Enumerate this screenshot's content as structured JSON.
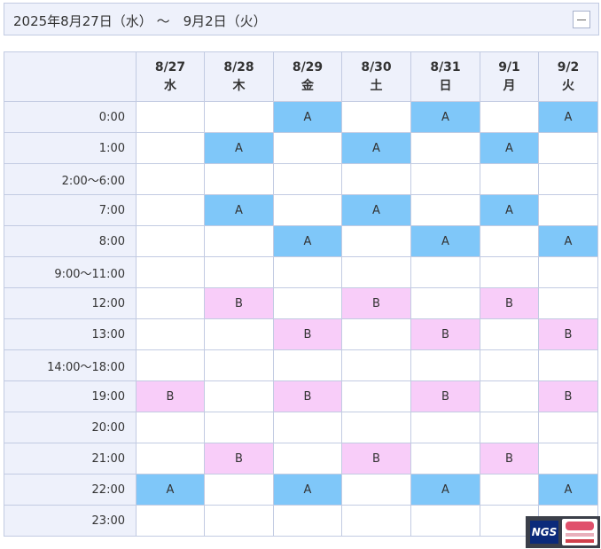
{
  "header": {
    "title": "2025年8月27日（水） ～　9月2日（火）"
  },
  "columns": [
    {
      "date": "8/27",
      "weekday": "水"
    },
    {
      "date": "8/28",
      "weekday": "木"
    },
    {
      "date": "8/29",
      "weekday": "金"
    },
    {
      "date": "8/30",
      "weekday": "土"
    },
    {
      "date": "8/31",
      "weekday": "日"
    },
    {
      "date": "9/1",
      "weekday": "月"
    },
    {
      "date": "9/2",
      "weekday": "火"
    }
  ],
  "rows": [
    {
      "time": "0:00",
      "cells": [
        "",
        "",
        "A",
        "",
        "A",
        "",
        "A"
      ]
    },
    {
      "time": "1:00",
      "cells": [
        "",
        "A",
        "",
        "A",
        "",
        "A",
        ""
      ]
    },
    {
      "time": "2:00～6:00",
      "cells": [
        "",
        "",
        "",
        "",
        "",
        "",
        ""
      ]
    },
    {
      "time": "7:00",
      "cells": [
        "",
        "A",
        "",
        "A",
        "",
        "A",
        ""
      ]
    },
    {
      "time": "8:00",
      "cells": [
        "",
        "",
        "A",
        "",
        "A",
        "",
        "A"
      ]
    },
    {
      "time": "9:00～11:00",
      "cells": [
        "",
        "",
        "",
        "",
        "",
        "",
        ""
      ]
    },
    {
      "time": "12:00",
      "cells": [
        "",
        "B",
        "",
        "B",
        "",
        "B",
        ""
      ]
    },
    {
      "time": "13:00",
      "cells": [
        "",
        "",
        "B",
        "",
        "B",
        "",
        "B"
      ]
    },
    {
      "time": "14:00～18:00",
      "cells": [
        "",
        "",
        "",
        "",
        "",
        "",
        ""
      ]
    },
    {
      "time": "19:00",
      "cells": [
        "B",
        "",
        "B",
        "",
        "B",
        "",
        "B"
      ]
    },
    {
      "time": "20:00",
      "cells": [
        "",
        "",
        "",
        "",
        "",
        "",
        ""
      ]
    },
    {
      "time": "21:00",
      "cells": [
        "",
        "B",
        "",
        "B",
        "",
        "B",
        ""
      ]
    },
    {
      "time": "22:00",
      "cells": [
        "A",
        "",
        "A",
        "",
        "A",
        "",
        "A"
      ]
    },
    {
      "time": "23:00",
      "cells": [
        "",
        "",
        "",
        "",
        "",
        "",
        ""
      ]
    }
  ],
  "colors": {
    "A": "#7fc7f9",
    "B": "#f8cdf9",
    "header_bg": "#eef1fb",
    "border": "#c2cbe2"
  },
  "logo": {
    "text": "NGS",
    "badge_icon": "broadcaster-badge-icon"
  }
}
